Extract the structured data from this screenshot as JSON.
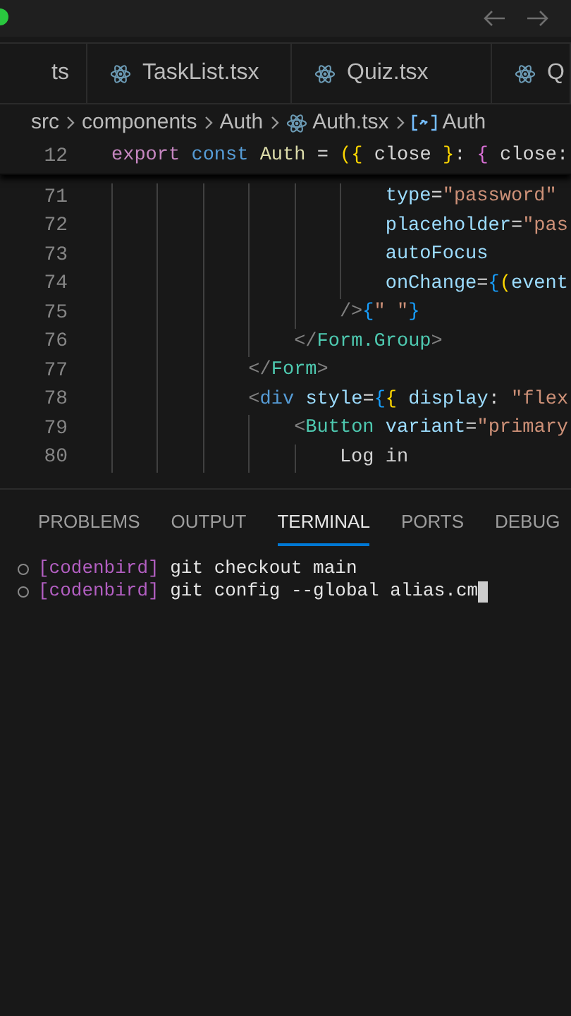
{
  "tabs": [
    {
      "label": "ts",
      "icon": false
    },
    {
      "label": "TaskList.tsx",
      "icon": true
    },
    {
      "label": "Quiz.tsx",
      "icon": true
    },
    {
      "label": "Q",
      "icon": true
    }
  ],
  "breadcrumb": [
    {
      "label": "src",
      "kind": "folder"
    },
    {
      "label": "components",
      "kind": "folder"
    },
    {
      "label": "Auth",
      "kind": "folder"
    },
    {
      "label": "Auth.tsx",
      "kind": "file"
    },
    {
      "label": "Auth",
      "kind": "symbol"
    }
  ],
  "sticky_line": {
    "number": "12",
    "tokens": [
      {
        "text": "export ",
        "color": "#c586c0"
      },
      {
        "text": "const ",
        "color": "#569cd6"
      },
      {
        "text": "Auth",
        "color": "#dcdcaa"
      },
      {
        "text": " = ",
        "color": "#d4d4d4"
      },
      {
        "text": "({",
        "color": "#ffd700"
      },
      {
        "text": " close ",
        "color": "#d4d4d4"
      },
      {
        "text": "}",
        "color": "#ffd700"
      },
      {
        "text": ": ",
        "color": "#d4d4d4"
      },
      {
        "text": "{",
        "color": "#da70d6"
      },
      {
        "text": " close:",
        "color": "#d4d4d4"
      }
    ]
  },
  "code": [
    {
      "children": [
        {
          "children": [
            {
              "children": [
                {
                  "children": [
                    {
                      "children": [
                        {
                          "children": [
                            {
                              "number": "71",
                              "tokens": [
                                {
                                  "text": "type",
                                  "color": "#9cdcfe"
                                },
                                {
                                  "text": "=",
                                  "color": "#d4d4d4"
                                },
                                {
                                  "text": "\"password\"",
                                  "color": "#ce9178"
                                }
                              ]
                            },
                            {
                              "number": "72",
                              "tokens": [
                                {
                                  "text": "placeholder",
                                  "color": "#9cdcfe"
                                },
                                {
                                  "text": "=",
                                  "color": "#d4d4d4"
                                },
                                {
                                  "text": "\"pas",
                                  "color": "#ce9178"
                                }
                              ]
                            },
                            {
                              "number": "73",
                              "tokens": [
                                {
                                  "text": "autoFocus",
                                  "color": "#9cdcfe"
                                }
                              ]
                            },
                            {
                              "number": "74",
                              "tokens": [
                                {
                                  "text": "onChange",
                                  "color": "#9cdcfe"
                                },
                                {
                                  "text": "=",
                                  "color": "#d4d4d4"
                                },
                                {
                                  "text": "{",
                                  "color": "#179fff"
                                },
                                {
                                  "text": "(",
                                  "color": "#ffd700"
                                },
                                {
                                  "text": "event",
                                  "color": "#9cdcfe"
                                }
                              ]
                            }
                          ]
                        },
                        {
                          "number": "75",
                          "tokens": [
                            {
                              "text": "/>",
                              "color": "#808080"
                            },
                            {
                              "text": "{",
                              "color": "#179fff"
                            },
                            {
                              "text": "\" \"",
                              "color": "#ce9178"
                            },
                            {
                              "text": "}",
                              "color": "#179fff"
                            }
                          ]
                        }
                      ]
                    },
                    {
                      "number": "76",
                      "tokens": [
                        {
                          "text": "</",
                          "color": "#808080"
                        },
                        {
                          "text": "Form.Group",
                          "color": "#4ec9b0"
                        },
                        {
                          "text": ">",
                          "color": "#808080"
                        }
                      ]
                    }
                  ]
                },
                {
                  "number": "77",
                  "tokens": [
                    {
                      "text": "</",
                      "color": "#808080"
                    },
                    {
                      "text": "Form",
                      "color": "#4ec9b0"
                    },
                    {
                      "text": ">",
                      "color": "#808080"
                    }
                  ]
                },
                {
                  "number": "78",
                  "tokens": [
                    {
                      "text": "<",
                      "color": "#808080"
                    },
                    {
                      "text": "div ",
                      "color": "#569cd6"
                    },
                    {
                      "text": "style",
                      "color": "#9cdcfe"
                    },
                    {
                      "text": "=",
                      "color": "#d4d4d4"
                    },
                    {
                      "text": "{",
                      "color": "#179fff"
                    },
                    {
                      "text": "{ ",
                      "color": "#ffd700"
                    },
                    {
                      "text": "display",
                      "color": "#9cdcfe"
                    },
                    {
                      "text": ": ",
                      "color": "#d4d4d4"
                    },
                    {
                      "text": "\"flex",
                      "color": "#ce9178"
                    }
                  ]
                },
                {
                  "children": [
                    {
                      "number": "79",
                      "tokens": [
                        {
                          "text": "<",
                          "color": "#808080"
                        },
                        {
                          "text": "Button ",
                          "color": "#4ec9b0"
                        },
                        {
                          "text": "variant",
                          "color": "#9cdcfe"
                        },
                        {
                          "text": "=",
                          "color": "#d4d4d4"
                        },
                        {
                          "text": "\"primary",
                          "color": "#ce9178"
                        }
                      ]
                    },
                    {
                      "children": [
                        {
                          "number": "80",
                          "tokens": [
                            {
                              "text": "Log in",
                              "color": "#d4d4d4"
                            }
                          ]
                        }
                      ]
                    }
                  ]
                }
              ]
            }
          ]
        }
      ]
    }
  ],
  "panel_tabs": [
    {
      "label": "PROBLEMS",
      "selected": false
    },
    {
      "label": "OUTPUT",
      "selected": false
    },
    {
      "label": "TERMINAL",
      "selected": true
    },
    {
      "label": "PORTS",
      "selected": false
    },
    {
      "label": "DEBUG",
      "selected": false
    }
  ],
  "terminal_lines": [
    {
      "prompt": "[codenbird]",
      "command": "git checkout main",
      "cursor": false
    },
    {
      "prompt": "[codenbird]",
      "command": "git config --global alias.cm",
      "cursor": true
    }
  ]
}
